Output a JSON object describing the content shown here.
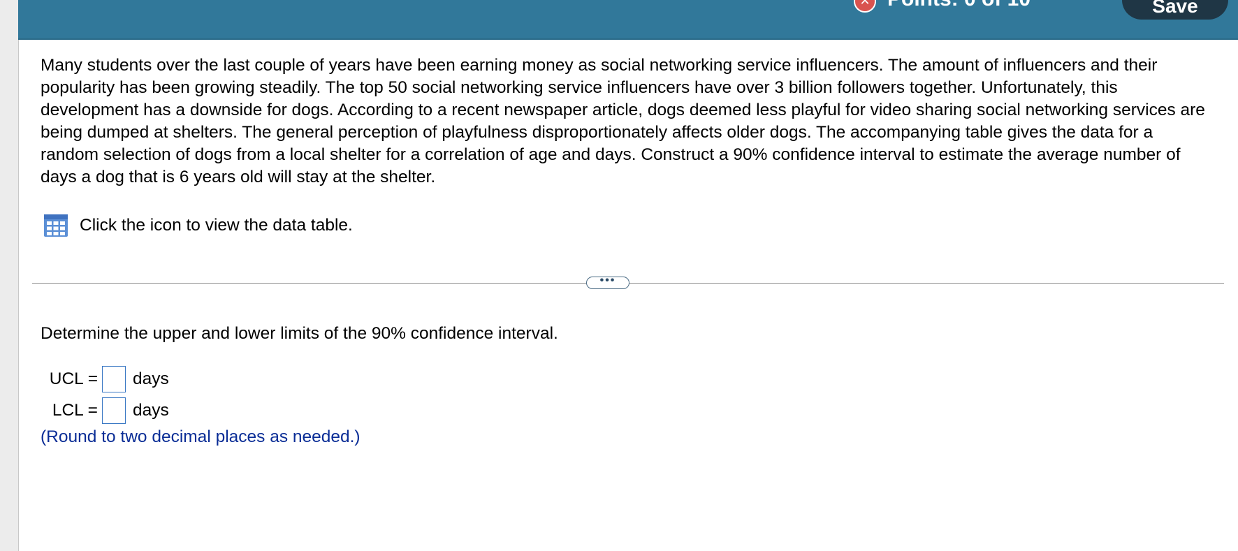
{
  "header": {
    "points_label": "Points: 0 of 10",
    "points_icon": "x-circle-icon",
    "save_label": "Save",
    "accent_color": "#31789a"
  },
  "problem": {
    "text": "Many students over the last couple of years have been earning money as social networking service influencers. The amount of influencers and their popularity has been growing steadily. The top 50 social networking service influencers have over 3 billion followers together. Unfortunately, this development has a downside for dogs. According to a recent newspaper article, dogs deemed less playful for video sharing social networking services are being dumped at shelters. The general perception of playfulness disproportionately affects older dogs. The accompanying table gives the data for a random selection of dogs from a local shelter for a correlation of age and days. Construct a 90% confidence interval to estimate the average number of days a dog that is 6 years old will stay at the shelter.",
    "data_link": "Click the icon to view the data table.",
    "data_icon": "table-grid-icon"
  },
  "divider": {
    "expand_label": "•••"
  },
  "question": {
    "prompt": "Determine the upper and lower limits of the 90% confidence interval.",
    "ucl_label": "UCL =",
    "lcl_label": "LCL =",
    "unit": "days",
    "ucl_value": "",
    "lcl_value": "",
    "note": "(Round to two decimal places as needed.)"
  }
}
